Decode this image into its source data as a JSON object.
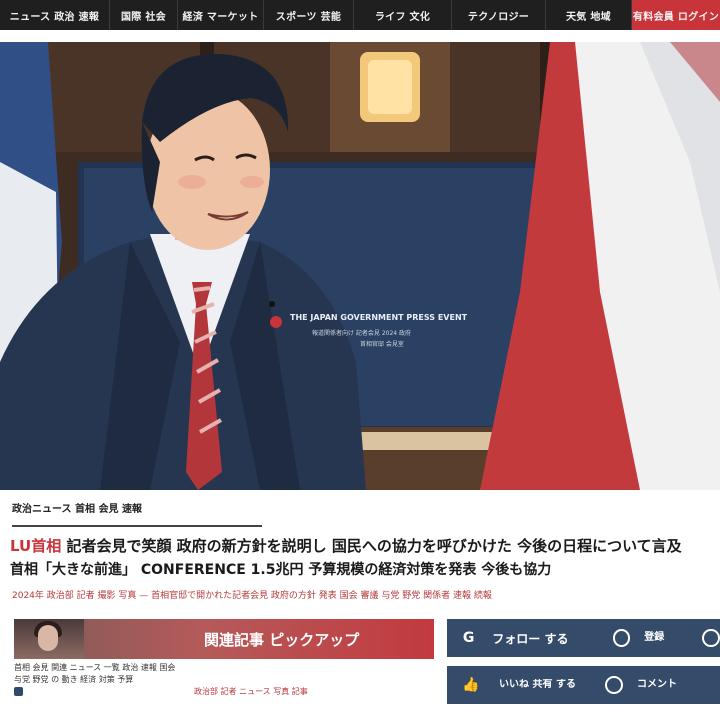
{
  "nav": {
    "items": [
      "ニュース 政治 速報",
      "国際 社会",
      "経済 マーケット",
      "スポーツ 芸能",
      "ライフ 文化",
      "テクノロジー",
      "天気 地域"
    ],
    "accent_item": "有料会員 ログイン",
    "accent_color": "#c8343a"
  },
  "hero": {
    "screen_title": "THE JAPAN GOVERNMENT PRESS EVENT",
    "screen_sub": "報道関係者向け 記者会見 2024 政府",
    "screen_sub2": "首相官邸 会見室"
  },
  "article": {
    "kicker": "政治ニュース 首相 会見 速報",
    "headline_red": "LU首相",
    "headline_rest": "記者会見で笑顔 政府の新方針を説明し 国民への協力を呼びかけた 今後の日程について言及",
    "headline2": "首相「大きな前進」 CONFERENCE 1.5兆円 予算規模の経済対策を発表 今後も協力",
    "byline": "2024年 政治部 記者 撮影 写真 — 首相官邸で開かれた記者会見 政府の方針 発表 国会 審議 与党 野党 関係者 速報 続報"
  },
  "related": {
    "title": "関連記事 ピックアップ",
    "line1": "首相 会見 関連 ニュース 一覧 政治 速報 国会",
    "line2": "与党 野党 の 動き 経済 対策 予算",
    "author": "政治部 記者 ニュース 写真 記事"
  },
  "widgets": {
    "a_label": "フォロー する",
    "a_right": "登録",
    "b_line1": "いいね 共有 する",
    "b_right": "コメント"
  },
  "colors": {
    "panel": "#344b6a",
    "nav": "#1f1f1f"
  }
}
